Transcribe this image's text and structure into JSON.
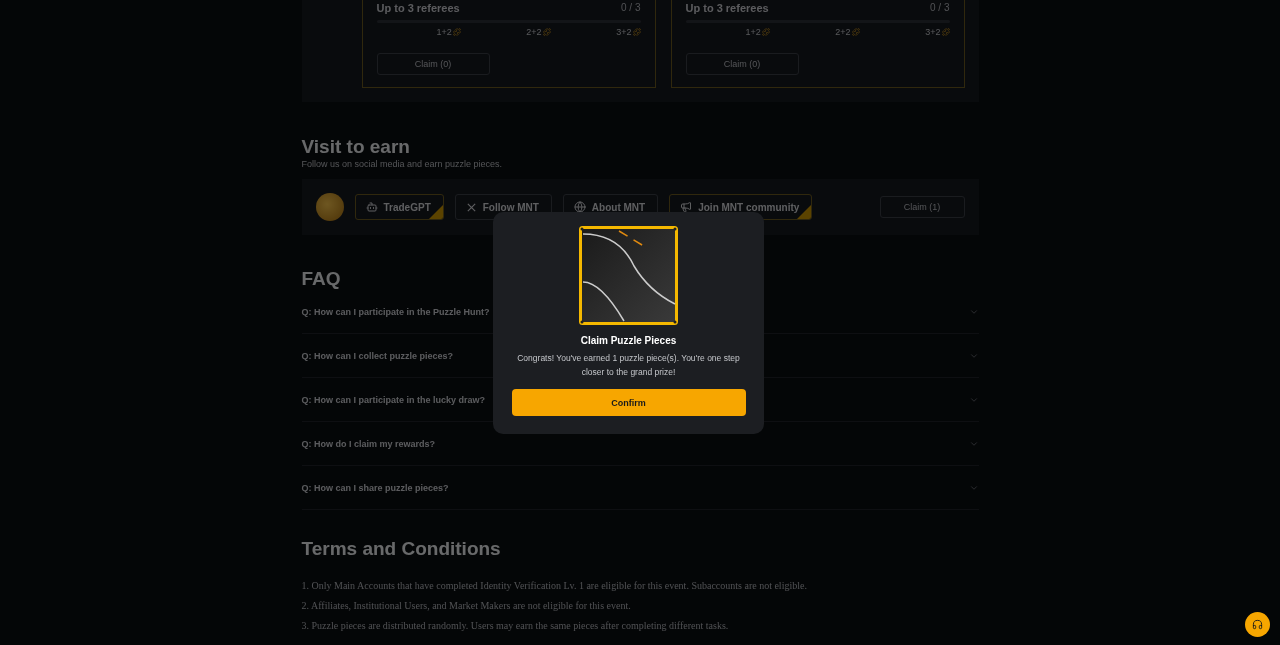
{
  "referral_cards": [
    {
      "title": "Up to 3 referees",
      "count": "0 / 3",
      "level": 0,
      "milestones": [
        "1+2",
        "2+2",
        "3+2"
      ],
      "claim": "Claim (0)"
    },
    {
      "title": "Up to 3 referees",
      "count": "0 / 3",
      "level": 0,
      "milestones": [
        "1+2",
        "2+2",
        "3+2"
      ],
      "claim": "Claim (0)"
    }
  ],
  "visit": {
    "title": "Visit to earn",
    "subtitle": "Follow us on social media and earn puzzle pieces.",
    "tasks": [
      {
        "label": "TradeGPT",
        "kind": "bot",
        "done": true
      },
      {
        "label": "Follow MNT",
        "kind": "x",
        "done": false
      },
      {
        "label": "About MNT",
        "kind": "globe",
        "done": false
      },
      {
        "label": "Join MNT community",
        "kind": "megaphone",
        "done": true
      }
    ],
    "claim": "Claim (1)"
  },
  "faq": {
    "title": "FAQ",
    "items": [
      {
        "question": "Q: How can I participate in the Puzzle Hunt?",
        "expanded": false
      },
      {
        "question": "Q: How can I collect puzzle pieces?",
        "expanded": false
      },
      {
        "question": "Q: How can I participate in the lucky draw?",
        "expanded": false
      },
      {
        "question": "Q: How do I claim my rewards?",
        "expanded": false
      },
      {
        "question": "Q: How can I share puzzle pieces?",
        "expanded": false
      }
    ]
  },
  "terms": {
    "title": "Terms and Conditions",
    "items": [
      "1. Only Main Accounts that have completed Identity Verification Lv. 1 are eligible for this event. Subaccounts are not eligible.",
      "2. Affiliates, Institutional Users, and Market Makers are not eligible for this event.",
      "3. Puzzle pieces are distributed randomly. Users may earn the same pieces after completing different tasks."
    ]
  },
  "modal": {
    "title": "Claim Puzzle Pieces",
    "message": "Congrats! You've earned 1 puzzle piece(s). You're one step closer to the grand prize!",
    "button": "Confirm"
  }
}
